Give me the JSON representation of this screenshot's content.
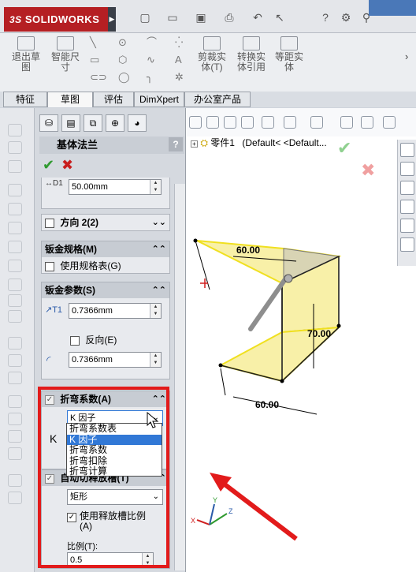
{
  "app": {
    "brand": "SOLIDWORKS",
    "brand_mark": "3S"
  },
  "ribbon": {
    "items": [
      {
        "label": "退出草\n图"
      },
      {
        "label": "智能尺\n寸"
      },
      {
        "label": "剪裁实\n体(T)"
      },
      {
        "label": "转换实\n体引用"
      },
      {
        "label": "等距实\n体"
      }
    ]
  },
  "tabs": [
    "特征",
    "草图",
    "评估",
    "DimXpert",
    "办公室产品"
  ],
  "property_manager": {
    "title": "基体法兰",
    "help": "?",
    "ok": "✔",
    "cancel": "✖",
    "top_value": "50.00mm",
    "direction2": {
      "label": "方向 2(2)"
    },
    "gauge": {
      "title": "钣金规格(M)",
      "use_gauge_table": "使用规格表(G)"
    },
    "sheet_params": {
      "title": "钣金参数(S)",
      "thickness": "0.7366mm",
      "reverse": "反向(E)",
      "radius": "0.7366mm"
    },
    "bend_allowance": {
      "title": "折弯系数(A)",
      "selected": "K 因子",
      "k_label": "K"
    },
    "dropdown_options": [
      "折弯系数表",
      "K 因子",
      "折弯系数",
      "折弯扣除",
      "折弯计算"
    ],
    "dropdown_selected_index": 1,
    "relief": {
      "title": "自动切释放槽(T)",
      "type": "矩形",
      "use_ratio": "使用释放槽比例\n(A)",
      "ratio_label": "比例(T):",
      "ratio_value": "0.5"
    }
  },
  "viewport": {
    "tree_part": "零件1",
    "tree_config": "(Default< <Default...",
    "dimensions": [
      "60.00",
      "70.00",
      "60.00"
    ],
    "axis": {
      "x": "X",
      "y": "Y",
      "z": "Z"
    }
  },
  "colors": {
    "brand": "#b51f23",
    "annotation": "#e21b1b",
    "sheet_fill": "#f8f0a8",
    "sheet_edge": "#f0e020",
    "selection": "#3178d6"
  }
}
